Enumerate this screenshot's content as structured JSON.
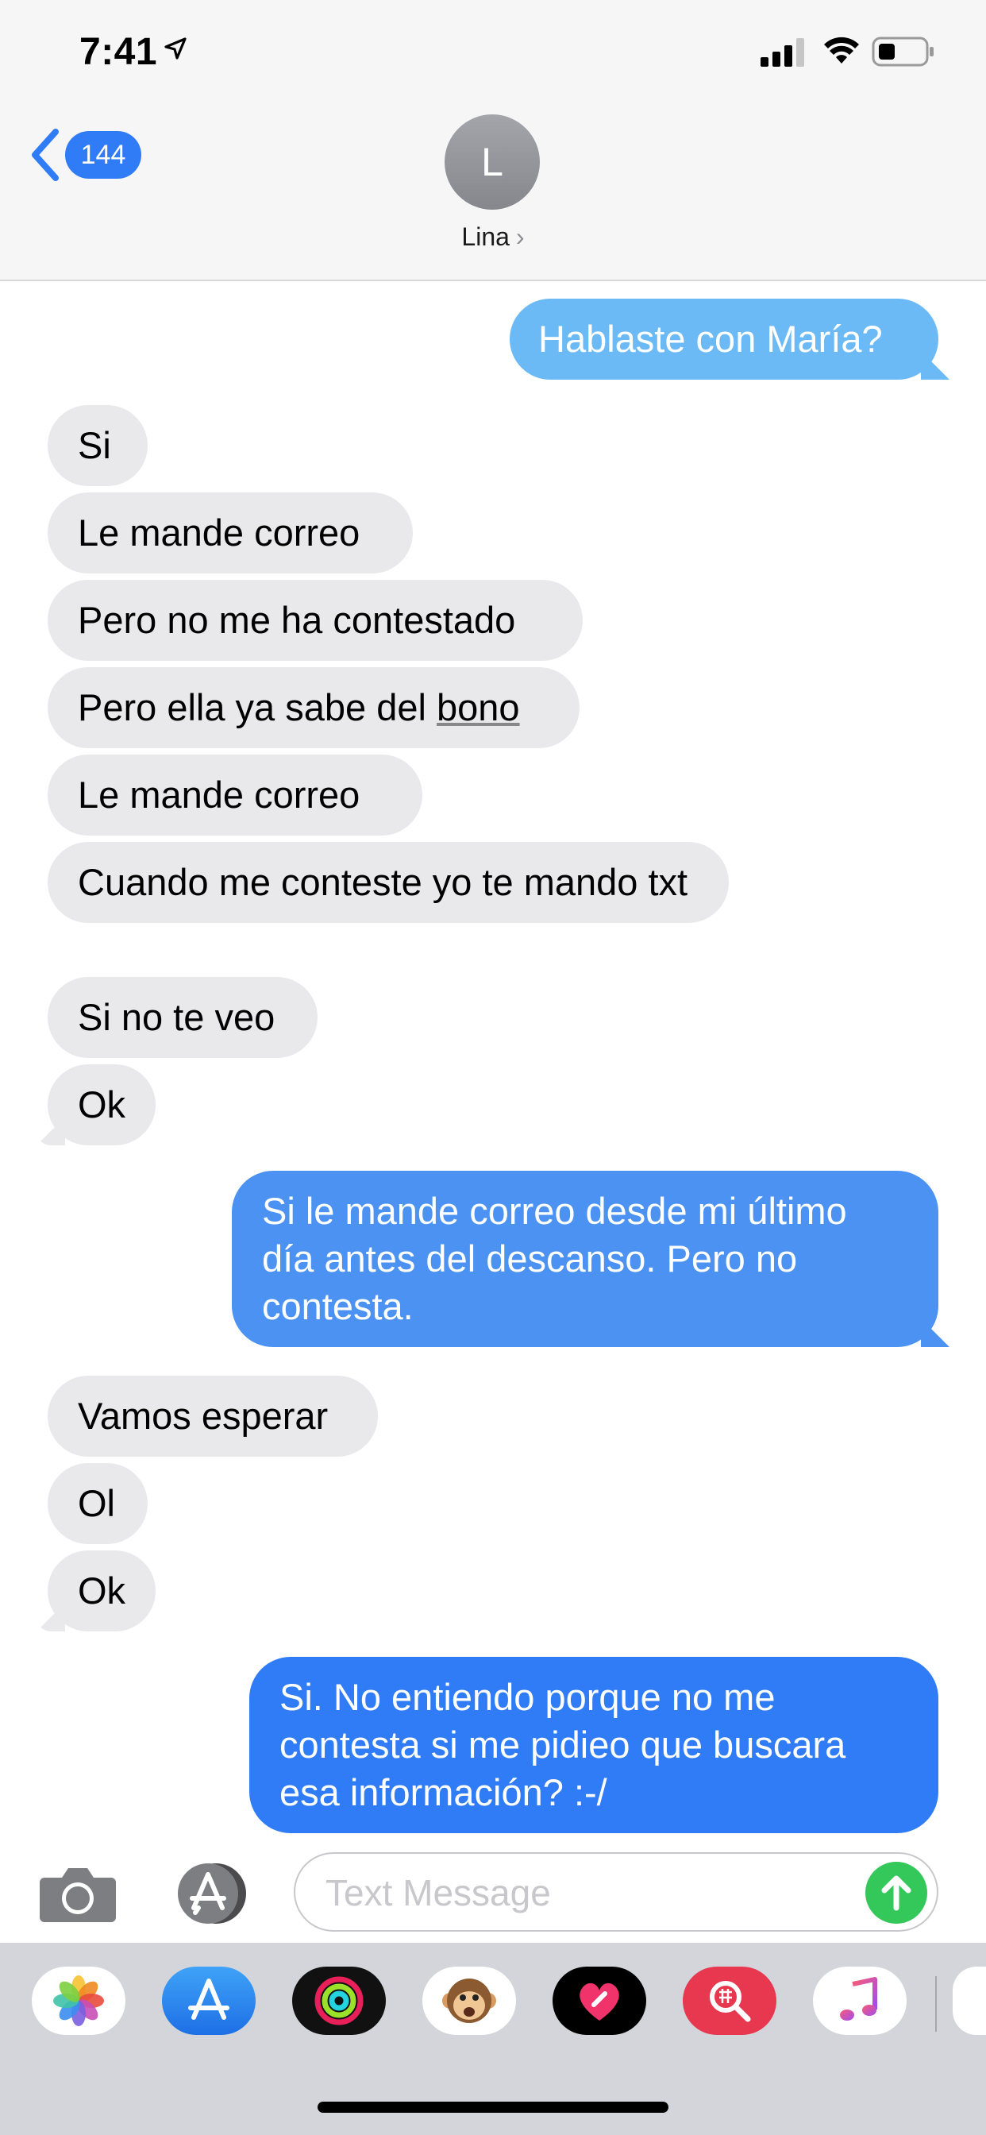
{
  "status_bar": {
    "time": "7:41",
    "icons": [
      "location-arrow-icon",
      "signal-icon",
      "wifi-icon",
      "battery-icon"
    ]
  },
  "header": {
    "back_count": "144",
    "avatar_initial": "L",
    "contact_name": "Lina",
    "contact_chevron": "›"
  },
  "messages": [
    {
      "from": "me",
      "text": "Hablaste con María?"
    },
    {
      "from": "them",
      "text": "Si"
    },
    {
      "from": "them",
      "text": "Le mande correo"
    },
    {
      "from": "them",
      "text": "Pero no me ha contestado"
    },
    {
      "from": "them",
      "text_before": "Pero ella ya sabe del ",
      "text_link": "bono"
    },
    {
      "from": "them",
      "text": "Le mande correo"
    },
    {
      "from": "them",
      "text": "Cuando me conteste yo te mando txt"
    },
    {
      "from": "them",
      "text": "Si no te veo"
    },
    {
      "from": "them",
      "text": "Ok"
    },
    {
      "from": "me",
      "text": "Si le mande correo desde mi último día antes del descanso. Pero no contesta."
    },
    {
      "from": "them",
      "text": "Vamos esperar"
    },
    {
      "from": "them",
      "text": "Ol"
    },
    {
      "from": "them",
      "text": "Ok"
    },
    {
      "from": "me",
      "text": "Si. No entiendo porque no me contesta si me pidieo que buscara esa información? :-/"
    }
  ],
  "input": {
    "placeholder": "Text Message"
  },
  "app_drawer": [
    "photos-icon",
    "app-store-icon",
    "activity-icon",
    "animoji-icon",
    "digital-touch-icon",
    "images-search-icon",
    "music-icon"
  ],
  "colors": {
    "incoming_bubble": "#e9e9eb",
    "outgoing_bubble_top": "#6cbaf5",
    "outgoing_bubble_mid": "#4b92f2",
    "outgoing_bubble_bottom": "#2f7cf6",
    "accent_blue": "#2f7cf6",
    "send_green": "#34c759"
  }
}
